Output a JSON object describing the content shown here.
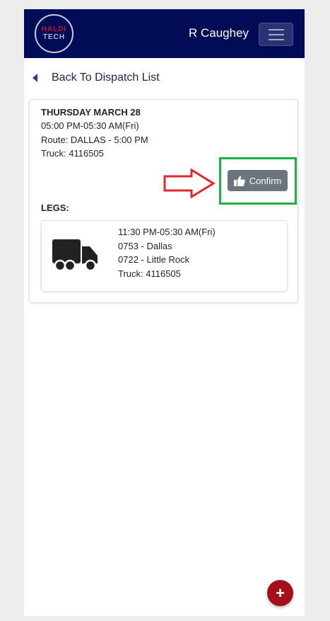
{
  "header": {
    "logo_top": "HALDI",
    "logo_bottom": "TECH",
    "user_name": "R Caughey",
    "menu_icon": "hamburger-icon"
  },
  "nav": {
    "back_label": "Back To Dispatch List"
  },
  "dispatch": {
    "date": "THURSDAY MARCH 28",
    "time": "05:00 PM-05:30 AM(Fri)",
    "route": "Route: DALLAS - 5:00 PM",
    "truck": "Truck: 4116505",
    "confirm_label": "Confirm",
    "legs_label": "LEGS:"
  },
  "legs": [
    {
      "time": "11:30 PM-05:30 AM(Fri)",
      "origin": "0753 - Dallas",
      "destination": "0722 - Little Rock",
      "truck": "Truck: 4116505"
    }
  ],
  "fab": {
    "label": "+"
  },
  "colors": {
    "navbar": "#020b55",
    "confirm_button": "#6c757d",
    "highlight_box": "#1fb043",
    "annotation_arrow": "#e0262e",
    "fab": "#a30f1a"
  }
}
